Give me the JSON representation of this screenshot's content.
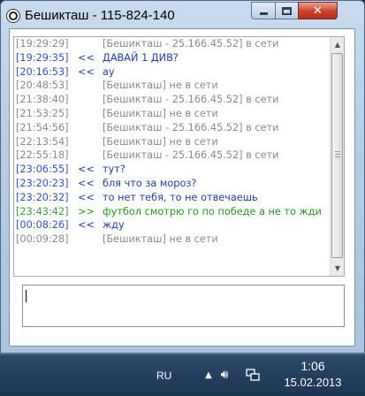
{
  "window": {
    "title": "Бешикташ - 115-824-140",
    "controls": {
      "minimize": "minimize",
      "maximize": "maximize",
      "close": "✕"
    }
  },
  "chat": {
    "rows": [
      {
        "time": "[19:29:29]",
        "arrow": "",
        "text": "[Бешикташ - 25.166.45.52] в сети",
        "color": "gray"
      },
      {
        "time": "[19:29:35]",
        "arrow": "<<",
        "text": "ДАВАЙ 1 ДИВ?",
        "color": "blue"
      },
      {
        "time": "[20:16:53]",
        "arrow": "<<",
        "text": "ау",
        "color": "blue"
      },
      {
        "time": "[20:48:53]",
        "arrow": "",
        "text": "[Бешикташ] не в сети",
        "color": "gray"
      },
      {
        "time": "[21:38:40]",
        "arrow": "",
        "text": "[Бешикташ - 25.166.45.52] в сети",
        "color": "gray"
      },
      {
        "time": "[21:53:25]",
        "arrow": "",
        "text": "[Бешикташ] не в сети",
        "color": "gray"
      },
      {
        "time": "[21:54:56]",
        "arrow": "",
        "text": "[Бешикташ - 25.166.45.52] в сети",
        "color": "gray"
      },
      {
        "time": "[22:13:54]",
        "arrow": "",
        "text": "[Бешикташ] не в сети",
        "color": "gray"
      },
      {
        "time": "[22:55:18]",
        "arrow": "",
        "text": "[Бешикташ - 25.166.45.52] в сети",
        "color": "gray"
      },
      {
        "time": "[23:06:55]",
        "arrow": "<<",
        "text": "тут?",
        "color": "blue"
      },
      {
        "time": "[23:20:23]",
        "arrow": "<<",
        "text": "бля что за мороз?",
        "color": "blue"
      },
      {
        "time": "[23:20:32]",
        "arrow": "<<",
        "text": "то нет тебя, то не отвечаешь",
        "color": "blue"
      },
      {
        "time": "[23:43:42]",
        "arrow": ">>",
        "text": "футбол смотрю го по победе а не то жди",
        "color": "green"
      },
      {
        "time": "[00:08:26]",
        "arrow": "<<",
        "text": "жду",
        "color": "blue"
      },
      {
        "time": "[00:09:28]",
        "arrow": "",
        "text": "[Бешикташ] не в сети",
        "color": "gray"
      }
    ],
    "input_value": ""
  },
  "taskbar": {
    "language": "RU",
    "time": "1:06",
    "date": "15.02.2013"
  },
  "colors": {
    "gray": "#8a8a8a",
    "blue": "#1f3fa6",
    "green": "#22991f"
  }
}
